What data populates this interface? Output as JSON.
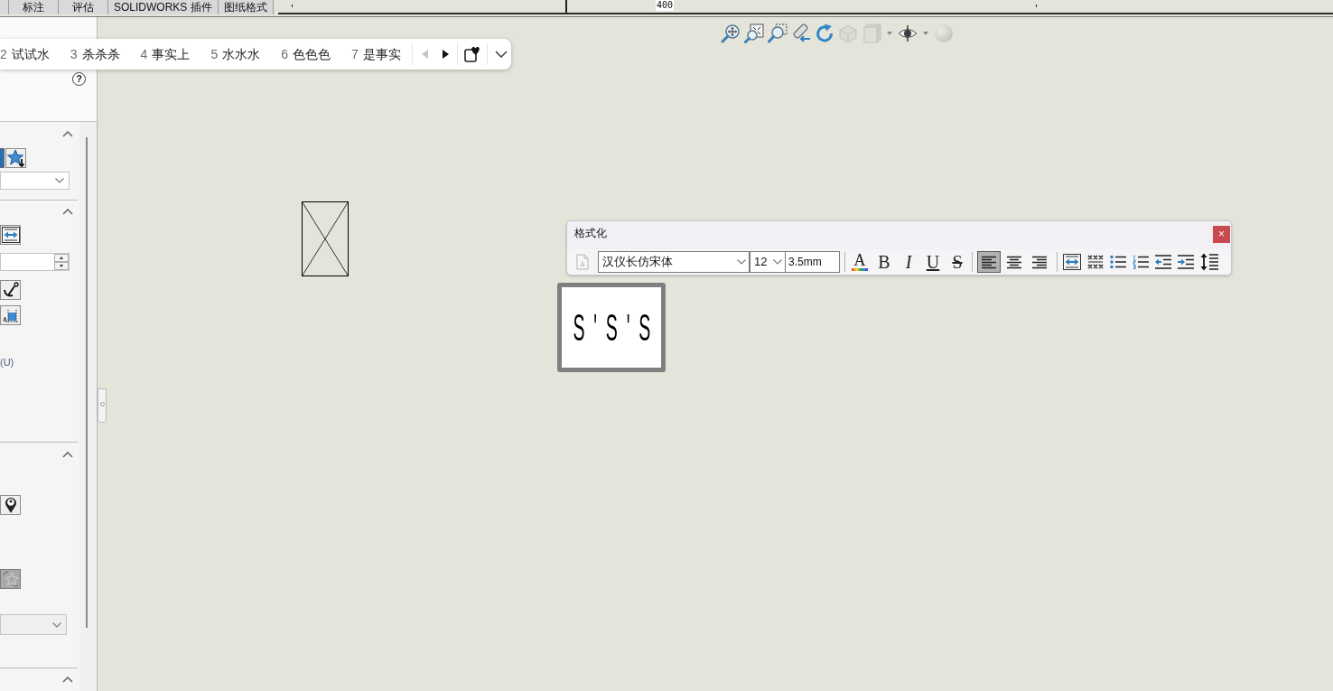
{
  "command_tabs": [
    {
      "label": "标注",
      "selected": false
    },
    {
      "label": "评估",
      "selected": false
    },
    {
      "label": "SOLIDWORKS 插件",
      "selected": false
    },
    {
      "label": "图纸格式",
      "selected": false
    }
  ],
  "ruler": {
    "labels": [
      "400"
    ]
  },
  "context_bar": {
    "items": [
      {
        "number": "2",
        "label": "试试水",
        "selected": false
      },
      {
        "number": "3",
        "label": "杀杀杀",
        "selected": false
      },
      {
        "number": "4",
        "label": "事实上",
        "selected": false
      },
      {
        "number": "5",
        "label": "水水水",
        "selected": false
      },
      {
        "number": "6",
        "label": "色色色",
        "selected": false
      },
      {
        "number": "7",
        "label": "是事实",
        "selected": false
      }
    ],
    "nav": [
      {
        "kind": "previous",
        "disabled": true
      },
      {
        "kind": "next",
        "disabled": false
      }
    ]
  },
  "property_panel": {
    "help": "?",
    "sections": [
      {
        "expanded": true,
        "controls": [
          {
            "kind": "iconpair",
            "disabled": false
          },
          {
            "kind": "dropdown",
            "disabled": false
          }
        ]
      },
      {
        "expanded": true,
        "controls": [
          {
            "kind": "width",
            "disabled": false
          },
          {
            "kind": "spinner",
            "disabled": false
          },
          {
            "kind": "anchor",
            "disabled": false
          },
          {
            "kind": "frame",
            "disabled": false
          },
          {
            "kind": "label",
            "text": "(U)",
            "disabled": false
          }
        ]
      },
      {
        "expanded": true,
        "controls": [
          {
            "kind": "pin",
            "disabled": false
          },
          {
            "kind": "star",
            "disabled": true
          },
          {
            "kind": "dropdown",
            "disabled": true
          }
        ]
      },
      {
        "expanded": true
      }
    ]
  },
  "view_tools": [
    {
      "kind": "fit",
      "disabled": false,
      "dropdown": false
    },
    {
      "kind": "area",
      "disabled": false,
      "dropdown": false
    },
    {
      "kind": "zoom",
      "disabled": false,
      "dropdown": false
    },
    {
      "kind": "previous",
      "disabled": false,
      "dropdown": false
    },
    {
      "kind": "redraw",
      "disabled": false,
      "dropdown": false
    },
    {
      "kind": "section",
      "disabled": true,
      "dropdown": false
    },
    {
      "kind": "display",
      "disabled": true,
      "dropdown": true
    },
    {
      "kind": "visibility",
      "disabled": false,
      "dropdown": true
    },
    {
      "kind": "scene",
      "disabled": true,
      "dropdown": false
    }
  ],
  "drawing": {
    "note": {
      "text": "S'S'S"
    }
  },
  "format_dialog": {
    "title": "格式化",
    "close": "×",
    "style_picker": {
      "disabled": true
    },
    "font": "汉仪长仿宋体",
    "size": "12",
    "height": "3.5mm",
    "text_styles": [
      {
        "kind": "color",
        "label": "A",
        "selected": false
      },
      {
        "kind": "bold",
        "label": "B",
        "selected": false
      },
      {
        "kind": "italic",
        "label": "I",
        "selected": false
      },
      {
        "kind": "underline",
        "label": "U",
        "selected": false
      },
      {
        "kind": "strike",
        "label": "S",
        "selected": false
      }
    ],
    "alignments": [
      {
        "kind": "left",
        "selected": true
      },
      {
        "kind": "center",
        "selected": false
      },
      {
        "kind": "right",
        "selected": false
      }
    ],
    "tools": [
      {
        "kind": "fit"
      },
      {
        "kind": "symbols"
      },
      {
        "kind": "bullets"
      },
      {
        "kind": "numbering"
      },
      {
        "kind": "outdent"
      },
      {
        "kind": "indent"
      },
      {
        "kind": "spacing"
      }
    ]
  }
}
